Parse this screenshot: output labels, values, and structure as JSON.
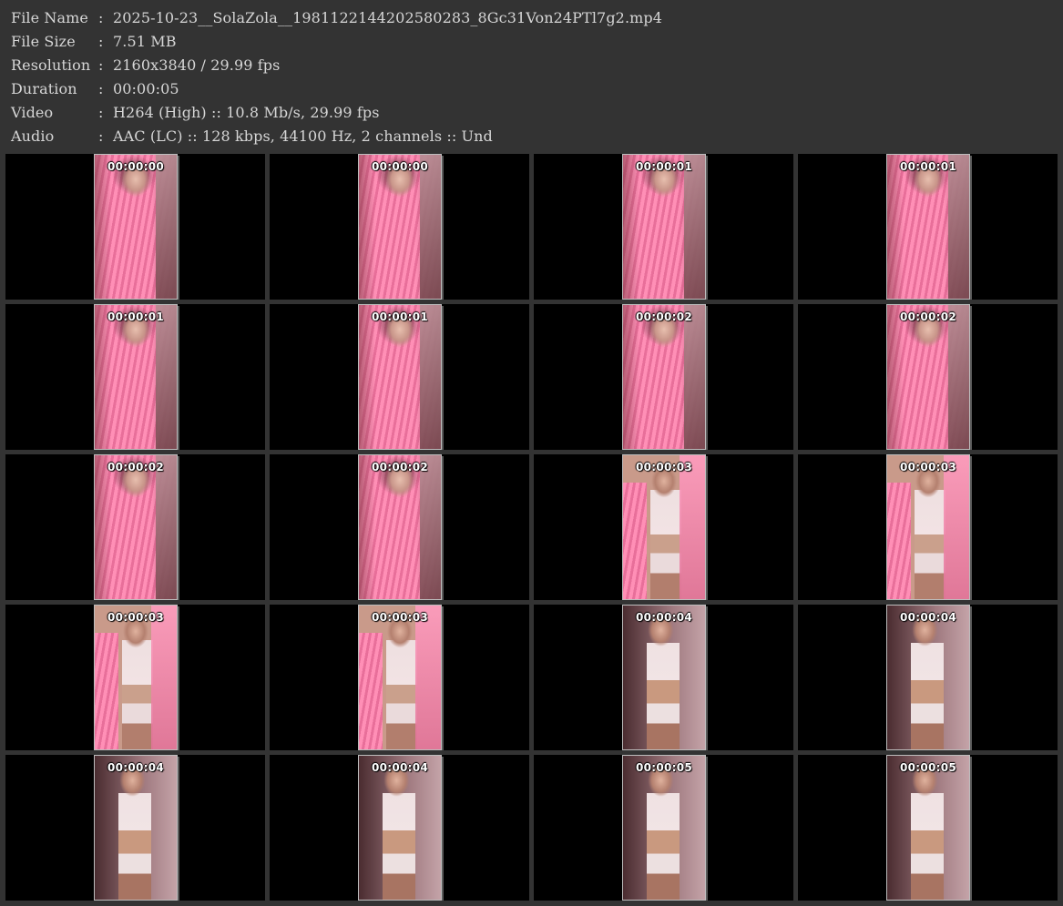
{
  "info": [
    {
      "label": "File Name",
      "sep": ":",
      "value": "2025-10-23__SolaZola__1981122144202580283_8Gc31Von24PTl7g2.mp4"
    },
    {
      "label": "File Size",
      "sep": ":",
      "value": "7.51 MB"
    },
    {
      "label": "Resolution",
      "sep": ":",
      "value": "2160x3840 / 29.99 fps"
    },
    {
      "label": "Duration",
      "sep": ":",
      "value": "00:00:05"
    },
    {
      "label": "Video",
      "sep": ":",
      "value": "H264 (High) :: 10.8 Mb/s, 29.99 fps"
    },
    {
      "label": "Audio",
      "sep": ":",
      "value": "AAC (LC) :: 128 kbps, 44100 Hz, 2 channels :: Und"
    }
  ],
  "thumbnails": [
    {
      "time": "00:00:00",
      "scene": "blanket"
    },
    {
      "time": "00:00:00",
      "scene": "blanket"
    },
    {
      "time": "00:00:01",
      "scene": "blanket"
    },
    {
      "time": "00:00:01",
      "scene": "blanket"
    },
    {
      "time": "00:00:01",
      "scene": "blanket"
    },
    {
      "time": "00:00:01",
      "scene": "blanket"
    },
    {
      "time": "00:00:02",
      "scene": "blanket"
    },
    {
      "time": "00:00:02",
      "scene": "blanket"
    },
    {
      "time": "00:00:02",
      "scene": "blanket"
    },
    {
      "time": "00:00:02",
      "scene": "blanket"
    },
    {
      "time": "00:00:03",
      "scene": "mixed"
    },
    {
      "time": "00:00:03",
      "scene": "mixed"
    },
    {
      "time": "00:00:03",
      "scene": "mixed"
    },
    {
      "time": "00:00:03",
      "scene": "mixed"
    },
    {
      "time": "00:00:04",
      "scene": "outfit"
    },
    {
      "time": "00:00:04",
      "scene": "outfit"
    },
    {
      "time": "00:00:04",
      "scene": "outfit"
    },
    {
      "time": "00:00:04",
      "scene": "outfit"
    },
    {
      "time": "00:00:05",
      "scene": "outfit"
    },
    {
      "time": "00:00:05",
      "scene": "outfit"
    }
  ],
  "colors": {
    "background": "#333333",
    "cell": "#000000",
    "text": "#d6d6d6",
    "timestamp": "#ffffff"
  }
}
